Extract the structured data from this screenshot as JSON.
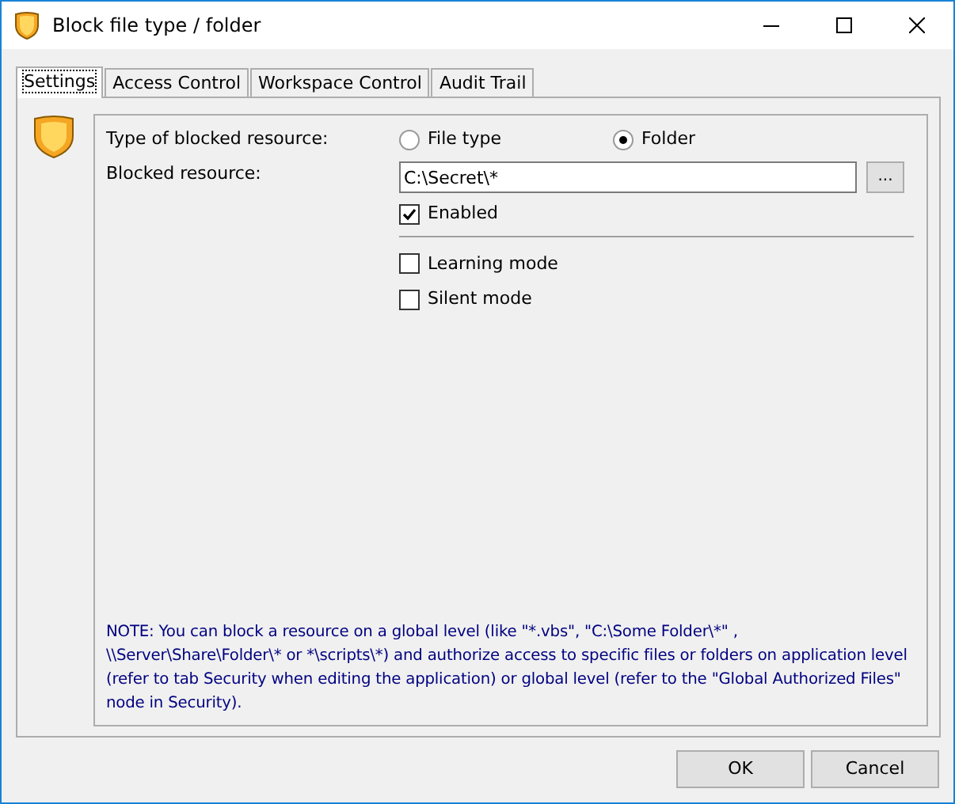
{
  "window": {
    "title": "Block file type / folder"
  },
  "tabs": [
    {
      "label": "Settings",
      "selected": true
    },
    {
      "label": "Access Control",
      "selected": false
    },
    {
      "label": "Workspace Control",
      "selected": false
    },
    {
      "label": "Audit Trail",
      "selected": false
    }
  ],
  "type_label": "Type of blocked resource:",
  "type_options": [
    {
      "label": "File type",
      "selected": false
    },
    {
      "label": "Folder",
      "selected": true
    }
  ],
  "resource_label": "Blocked resource:",
  "resource_value": "C:\\Secret\\*",
  "browse_button": "...",
  "enabled": {
    "label": "Enabled",
    "checked": true
  },
  "modes": [
    {
      "label": "Learning mode",
      "checked": false
    },
    {
      "label": "Silent mode",
      "checked": false
    }
  ],
  "note": "NOTE: You can block a resource on a global level (like \"*.vbs\", \"C:\\Some Folder\\*\" , \\\\Server\\Share\\Folder\\* or *\\scripts\\*) and authorize access to specific files or folders on application level (refer to tab Security when editing the application) or global level (refer to the \"Global Authorized Files\" node in Security).",
  "buttons": [
    "OK",
    "Cancel"
  ]
}
